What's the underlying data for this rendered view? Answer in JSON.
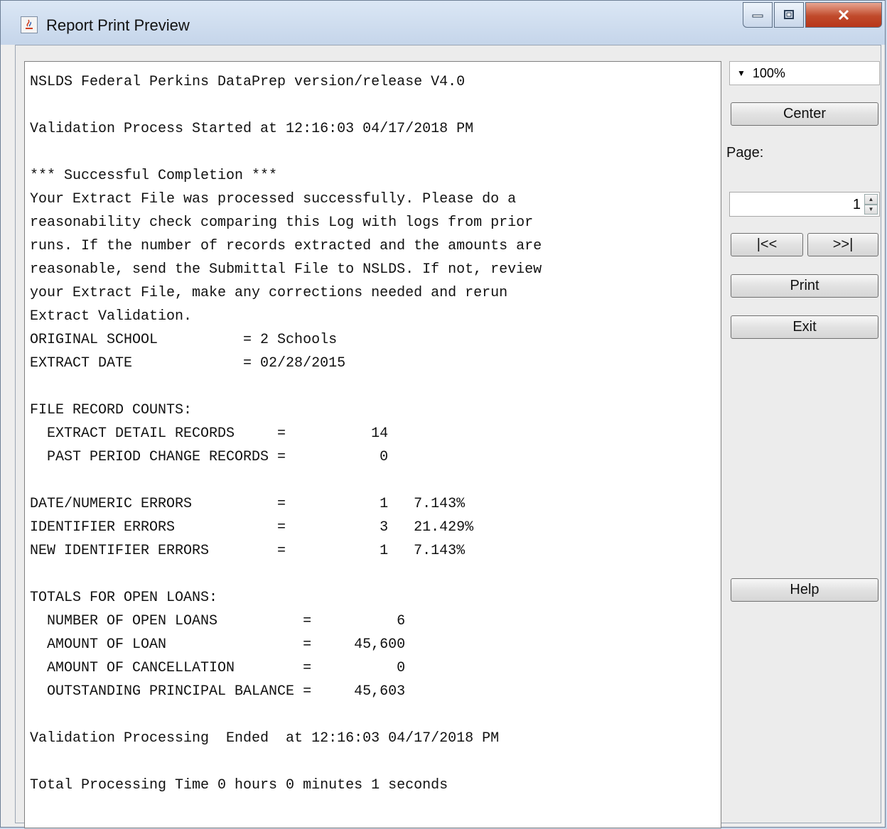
{
  "window": {
    "title": "Report Print Preview"
  },
  "report": {
    "lines": [
      "NSLDS Federal Perkins DataPrep version/release V4.0",
      "",
      "Validation Process Started at 12:16:03 04/17/2018 PM",
      "",
      "*** Successful Completion ***",
      "Your Extract File was processed successfully. Please do a",
      "reasonability check comparing this Log with logs from prior",
      "runs. If the number of records extracted and the amounts are",
      "reasonable, send the Submittal File to NSLDS. If not, review",
      "your Extract File, make any corrections needed and rerun",
      "Extract Validation.",
      "ORIGINAL SCHOOL          = 2 Schools",
      "EXTRACT DATE             = 02/28/2015",
      "",
      "FILE RECORD COUNTS:",
      "  EXTRACT DETAIL RECORDS     =          14",
      "  PAST PERIOD CHANGE RECORDS =           0",
      "",
      "DATE/NUMERIC ERRORS          =           1   7.143%",
      "IDENTIFIER ERRORS            =           3   21.429%",
      "NEW IDENTIFIER ERRORS        =           1   7.143%",
      "",
      "TOTALS FOR OPEN LOANS:",
      "  NUMBER OF OPEN LOANS          =          6",
      "  AMOUNT OF LOAN                =     45,600",
      "  AMOUNT OF CANCELLATION        =          0",
      "  OUTSTANDING PRINCIPAL BALANCE =     45,603",
      "",
      "Validation Processing  Ended  at 12:16:03 04/17/2018 PM",
      "",
      "Total Processing Time 0 hours 0 minutes 1 seconds"
    ]
  },
  "sidebar": {
    "zoom_value": "100%",
    "center_label": "Center",
    "page_label": "Page:",
    "page_value": "1",
    "first_label": "|<<",
    "last_label": ">>|",
    "print_label": "Print",
    "exit_label": "Exit",
    "help_label": "Help"
  }
}
